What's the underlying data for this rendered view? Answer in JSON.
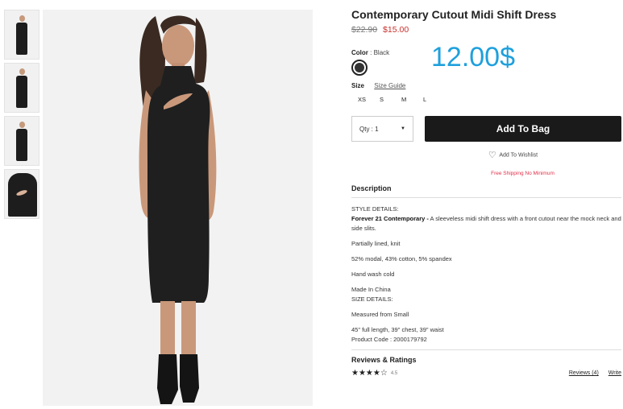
{
  "product": {
    "title": "Contemporary Cutout Midi Shift Dress",
    "old_price": "$22.90",
    "sale_price": "$15.00",
    "overlay_price": "12.00$"
  },
  "color": {
    "label": "Color",
    "separator": ":",
    "value": "Black",
    "swatch_hex": "#333333"
  },
  "size": {
    "label": "Size",
    "guide_link": "Size Guide",
    "options": [
      "XS",
      "S",
      "M",
      "L"
    ]
  },
  "quantity": {
    "label": "Qty : 1"
  },
  "buttons": {
    "add_to_bag": "Add To Bag",
    "add_to_wishlist": "Add To Wishlist"
  },
  "shipping_note": "Free Shipping No Minimum",
  "description": {
    "heading": "Description",
    "style_details_label": "STYLE DETAILS:",
    "brand_line": "Forever 21 Contemporary -",
    "summary": "A sleeveless midi shift dress with a front cutout near the mock neck and side slits.",
    "details": [
      "Partially lined, knit",
      "52% modal, 43% cotton, 5% spandex",
      "Hand wash cold",
      "Made In China"
    ],
    "size_details_label": "SIZE DETAILS:",
    "size_details": [
      "Measured from Small",
      "45\" full length, 39\" chest, 39\" waist"
    ],
    "product_code": "Product Code : 2000179792"
  },
  "reviews": {
    "heading": "Reviews & Ratings",
    "stars": "★★★★☆",
    "rating": "4.5",
    "reviews_link": "Reviews (4)",
    "write_link": "Write"
  }
}
